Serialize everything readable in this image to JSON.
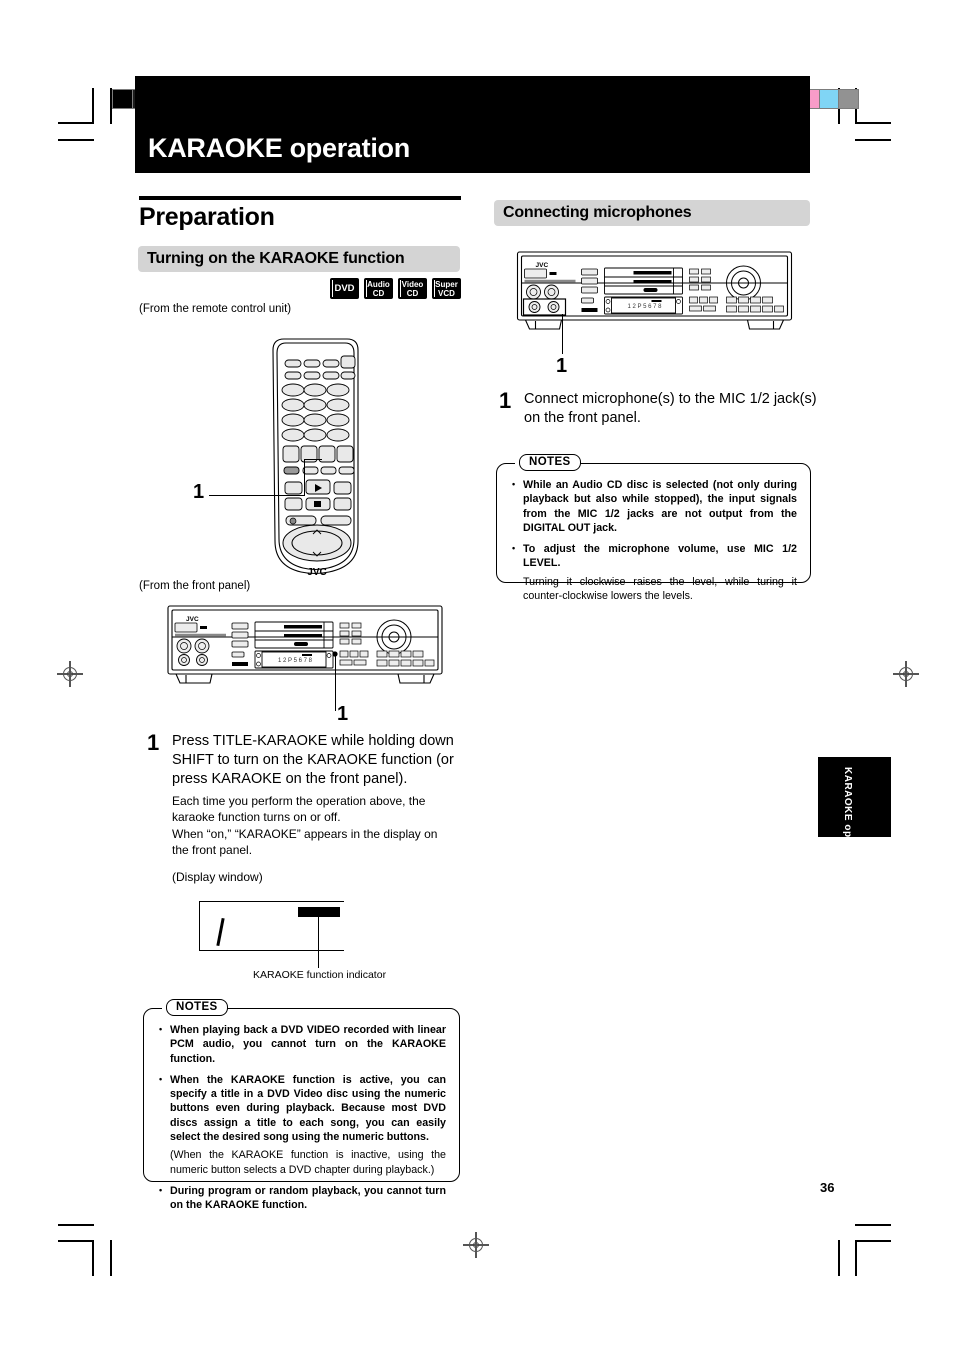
{
  "page": {
    "number": "36",
    "side_tab": "KARAOKE operation",
    "header_title": "KARAOKE operation"
  },
  "marks": {
    "grayscale_swatches": [
      "#000000",
      "#1c1c1c",
      "#343434",
      "#4d4d4d",
      "#676767",
      "#808080",
      "#999999",
      "#b2b2b2",
      "#cacaca",
      "#e5e5e5",
      "#ffffff"
    ],
    "color_swatches": [
      "#ffe600",
      "#ec008c",
      "#00a6e8",
      "#2e3192",
      "#00a651",
      "#ed1c24",
      "#231f20",
      "#fff79a",
      "#f89cc8",
      "#80d5f5",
      "#929292"
    ]
  },
  "left_column": {
    "h1": "Preparation",
    "h2": "Turning on the KARAOKE function",
    "badges": [
      {
        "name": "dvd-badge",
        "line1": "DVD",
        "line2": ""
      },
      {
        "name": "audio-cd-badge",
        "line1": "Audio",
        "line2": "CD"
      },
      {
        "name": "video-cd-badge",
        "line1": "Video",
        "line2": "CD"
      },
      {
        "name": "super-vcd-badge",
        "line1": "Super",
        "line2": "VCD"
      }
    ],
    "caption_remote": "(From the remote control unit)",
    "caption_front_panel": "(From the front panel)",
    "callout_remote": "1",
    "callout_front_panel": "1",
    "step": {
      "number": "1",
      "text": "Press TITLE-KARAOKE while holding down SHIFT to turn on the KARAOKE function (or press KARAOKE on the front panel).",
      "para1": "Each time you perform the operation above, the karaoke function turns on or off.",
      "para2": "When “on,” “KARAOKE” appears in the display on the front panel.",
      "display_window_caption": "(Display window)",
      "indicator_caption": "KARAOKE function indicator"
    },
    "notes": {
      "title": "NOTES",
      "items": [
        {
          "style": "bullet",
          "text": "When playing back a DVD VIDEO recorded with linear PCM audio, you cannot turn on the KARAOKE function."
        },
        {
          "style": "bullet",
          "text": "When the KARAOKE function is active, you can specify a title in a DVD Video disc using the numeric buttons even during playback. Because most DVD discs assign a title to each song, you can easily select the desired song using the numeric buttons."
        },
        {
          "style": "plain",
          "text": "(When the KARAOKE function is inactive, using the numeric button selects a DVD chapter during playback.)"
        },
        {
          "style": "bullet",
          "text": "During program or random playback, you cannot turn on the KARAOKE function."
        }
      ]
    }
  },
  "right_column": {
    "h2": "Connecting microphones",
    "callout": "1",
    "step": {
      "number": "1",
      "text": "Connect microphone(s) to the MIC 1/2 jack(s) on the front panel."
    },
    "notes": {
      "title": "NOTES",
      "items": [
        {
          "style": "bullet",
          "text": "While an Audio CD disc is selected (not only during playback but also while stopped), the input signals from the MIC 1/2 jacks are not output from the DIGITAL OUT jack."
        },
        {
          "style": "bullet",
          "text": "To adjust the microphone volume, use MIC 1/2 LEVEL."
        },
        {
          "style": "plain",
          "text": "Turning it clockwise raises the level, while turing it counter-clockwise lowers the levels."
        }
      ]
    }
  },
  "illustrations": {
    "remote_brand": "JVC",
    "front_panel_brand": "JVC",
    "front_panel_display_text": "1 2 P 5 6 7 8"
  }
}
